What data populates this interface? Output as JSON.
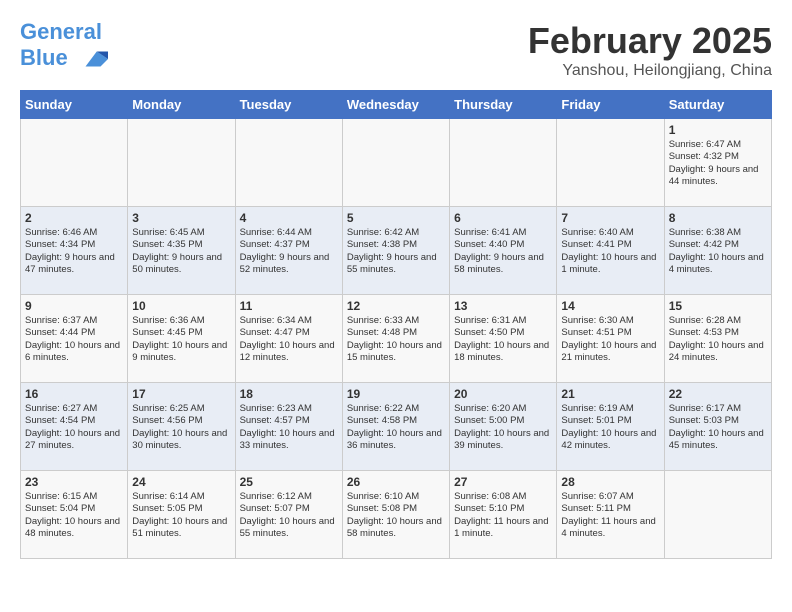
{
  "header": {
    "logo_line1": "General",
    "logo_line2": "Blue",
    "title": "February 2025",
    "subtitle": "Yanshou, Heilongjiang, China"
  },
  "weekdays": [
    "Sunday",
    "Monday",
    "Tuesday",
    "Wednesday",
    "Thursday",
    "Friday",
    "Saturday"
  ],
  "weeks": [
    [
      {
        "day": "",
        "info": ""
      },
      {
        "day": "",
        "info": ""
      },
      {
        "day": "",
        "info": ""
      },
      {
        "day": "",
        "info": ""
      },
      {
        "day": "",
        "info": ""
      },
      {
        "day": "",
        "info": ""
      },
      {
        "day": "1",
        "info": "Sunrise: 6:47 AM\nSunset: 4:32 PM\nDaylight: 9 hours and 44 minutes."
      }
    ],
    [
      {
        "day": "2",
        "info": "Sunrise: 6:46 AM\nSunset: 4:34 PM\nDaylight: 9 hours and 47 minutes."
      },
      {
        "day": "3",
        "info": "Sunrise: 6:45 AM\nSunset: 4:35 PM\nDaylight: 9 hours and 50 minutes."
      },
      {
        "day": "4",
        "info": "Sunrise: 6:44 AM\nSunset: 4:37 PM\nDaylight: 9 hours and 52 minutes."
      },
      {
        "day": "5",
        "info": "Sunrise: 6:42 AM\nSunset: 4:38 PM\nDaylight: 9 hours and 55 minutes."
      },
      {
        "day": "6",
        "info": "Sunrise: 6:41 AM\nSunset: 4:40 PM\nDaylight: 9 hours and 58 minutes."
      },
      {
        "day": "7",
        "info": "Sunrise: 6:40 AM\nSunset: 4:41 PM\nDaylight: 10 hours and 1 minute."
      },
      {
        "day": "8",
        "info": "Sunrise: 6:38 AM\nSunset: 4:42 PM\nDaylight: 10 hours and 4 minutes."
      }
    ],
    [
      {
        "day": "9",
        "info": "Sunrise: 6:37 AM\nSunset: 4:44 PM\nDaylight: 10 hours and 6 minutes."
      },
      {
        "day": "10",
        "info": "Sunrise: 6:36 AM\nSunset: 4:45 PM\nDaylight: 10 hours and 9 minutes."
      },
      {
        "day": "11",
        "info": "Sunrise: 6:34 AM\nSunset: 4:47 PM\nDaylight: 10 hours and 12 minutes."
      },
      {
        "day": "12",
        "info": "Sunrise: 6:33 AM\nSunset: 4:48 PM\nDaylight: 10 hours and 15 minutes."
      },
      {
        "day": "13",
        "info": "Sunrise: 6:31 AM\nSunset: 4:50 PM\nDaylight: 10 hours and 18 minutes."
      },
      {
        "day": "14",
        "info": "Sunrise: 6:30 AM\nSunset: 4:51 PM\nDaylight: 10 hours and 21 minutes."
      },
      {
        "day": "15",
        "info": "Sunrise: 6:28 AM\nSunset: 4:53 PM\nDaylight: 10 hours and 24 minutes."
      }
    ],
    [
      {
        "day": "16",
        "info": "Sunrise: 6:27 AM\nSunset: 4:54 PM\nDaylight: 10 hours and 27 minutes."
      },
      {
        "day": "17",
        "info": "Sunrise: 6:25 AM\nSunset: 4:56 PM\nDaylight: 10 hours and 30 minutes."
      },
      {
        "day": "18",
        "info": "Sunrise: 6:23 AM\nSunset: 4:57 PM\nDaylight: 10 hours and 33 minutes."
      },
      {
        "day": "19",
        "info": "Sunrise: 6:22 AM\nSunset: 4:58 PM\nDaylight: 10 hours and 36 minutes."
      },
      {
        "day": "20",
        "info": "Sunrise: 6:20 AM\nSunset: 5:00 PM\nDaylight: 10 hours and 39 minutes."
      },
      {
        "day": "21",
        "info": "Sunrise: 6:19 AM\nSunset: 5:01 PM\nDaylight: 10 hours and 42 minutes."
      },
      {
        "day": "22",
        "info": "Sunrise: 6:17 AM\nSunset: 5:03 PM\nDaylight: 10 hours and 45 minutes."
      }
    ],
    [
      {
        "day": "23",
        "info": "Sunrise: 6:15 AM\nSunset: 5:04 PM\nDaylight: 10 hours and 48 minutes."
      },
      {
        "day": "24",
        "info": "Sunrise: 6:14 AM\nSunset: 5:05 PM\nDaylight: 10 hours and 51 minutes."
      },
      {
        "day": "25",
        "info": "Sunrise: 6:12 AM\nSunset: 5:07 PM\nDaylight: 10 hours and 55 minutes."
      },
      {
        "day": "26",
        "info": "Sunrise: 6:10 AM\nSunset: 5:08 PM\nDaylight: 10 hours and 58 minutes."
      },
      {
        "day": "27",
        "info": "Sunrise: 6:08 AM\nSunset: 5:10 PM\nDaylight: 11 hours and 1 minute."
      },
      {
        "day": "28",
        "info": "Sunrise: 6:07 AM\nSunset: 5:11 PM\nDaylight: 11 hours and 4 minutes."
      },
      {
        "day": "",
        "info": ""
      }
    ]
  ]
}
